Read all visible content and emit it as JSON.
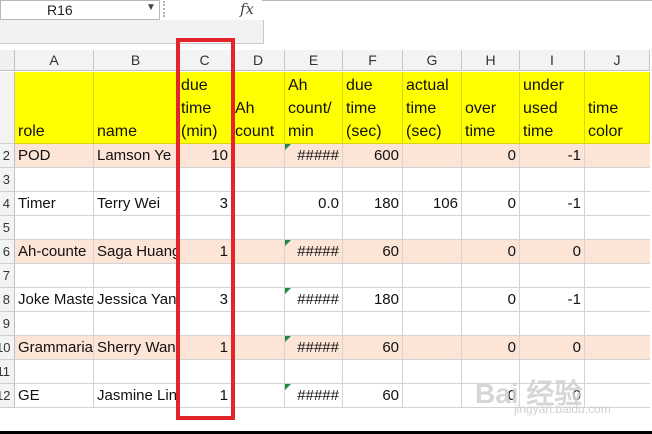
{
  "formula_bar": {
    "name_box": "R16",
    "fx": "fx"
  },
  "columns": [
    "A",
    "B",
    "C",
    "D",
    "E",
    "F",
    "G",
    "H",
    "I",
    "J"
  ],
  "headers": [
    "role",
    "name",
    "due\ntime\n(min)",
    "Ah\ncount",
    "Ah\ncount/\nmin",
    "due\ntime\n(sec)",
    "actual\ntime\n(sec)",
    "over\ntime",
    "under\nused\ntime",
    "time\ncolor"
  ],
  "rows": [
    {
      "num": "2",
      "cells": [
        "POD",
        "Lamson Ye",
        "10",
        "",
        "#####",
        "600",
        "",
        "0",
        "-1",
        ""
      ],
      "tint": "peach",
      "flag": true
    },
    {
      "num": "3",
      "cells": [
        "",
        "",
        "",
        "",
        "",
        "",
        "",
        "",
        "",
        ""
      ],
      "tint": "white",
      "flag": false
    },
    {
      "num": "4",
      "cells": [
        "Timer",
        "Terry Wei",
        "3",
        "",
        "0.0",
        "180",
        "106",
        "0",
        "-1",
        ""
      ],
      "tint": "white",
      "flag": false
    },
    {
      "num": "5",
      "cells": [
        "",
        "",
        "",
        "",
        "",
        "",
        "",
        "",
        "",
        ""
      ],
      "tint": "white",
      "flag": false
    },
    {
      "num": "6",
      "cells": [
        "Ah-counte",
        "Saga Huang",
        "1",
        "",
        "#####",
        "60",
        "",
        "0",
        "0",
        ""
      ],
      "tint": "peach",
      "flag": true
    },
    {
      "num": "7",
      "cells": [
        "",
        "",
        "",
        "",
        "",
        "",
        "",
        "",
        "",
        ""
      ],
      "tint": "white",
      "flag": false
    },
    {
      "num": "8",
      "cells": [
        "Joke Maste",
        "Jessica Yan",
        "3",
        "",
        "#####",
        "180",
        "",
        "0",
        "-1",
        ""
      ],
      "tint": "white",
      "flag": true
    },
    {
      "num": "9",
      "cells": [
        "",
        "",
        "",
        "",
        "",
        "",
        "",
        "",
        "",
        ""
      ],
      "tint": "white",
      "flag": false
    },
    {
      "num": "10",
      "cells": [
        "Grammaria",
        "Sherry Wan",
        "1",
        "",
        "#####",
        "60",
        "",
        "0",
        "0",
        ""
      ],
      "tint": "peach",
      "flag": true
    },
    {
      "num": "11",
      "cells": [
        "",
        "",
        "",
        "",
        "",
        "",
        "",
        "",
        "",
        ""
      ],
      "tint": "white",
      "flag": false
    },
    {
      "num": "12",
      "cells": [
        "GE",
        "Jasmine Lin",
        "1",
        "",
        "#####",
        "60",
        "",
        "0",
        "0",
        ""
      ],
      "tint": "white",
      "flag": true
    }
  ],
  "watermark": {
    "text": "Bai 经验",
    "sub": "jingyan.baidu.com"
  },
  "colors": {
    "header_fill": "#ffff00",
    "row_fill": "#fce4d6",
    "highlight_box": "#e3242b"
  }
}
